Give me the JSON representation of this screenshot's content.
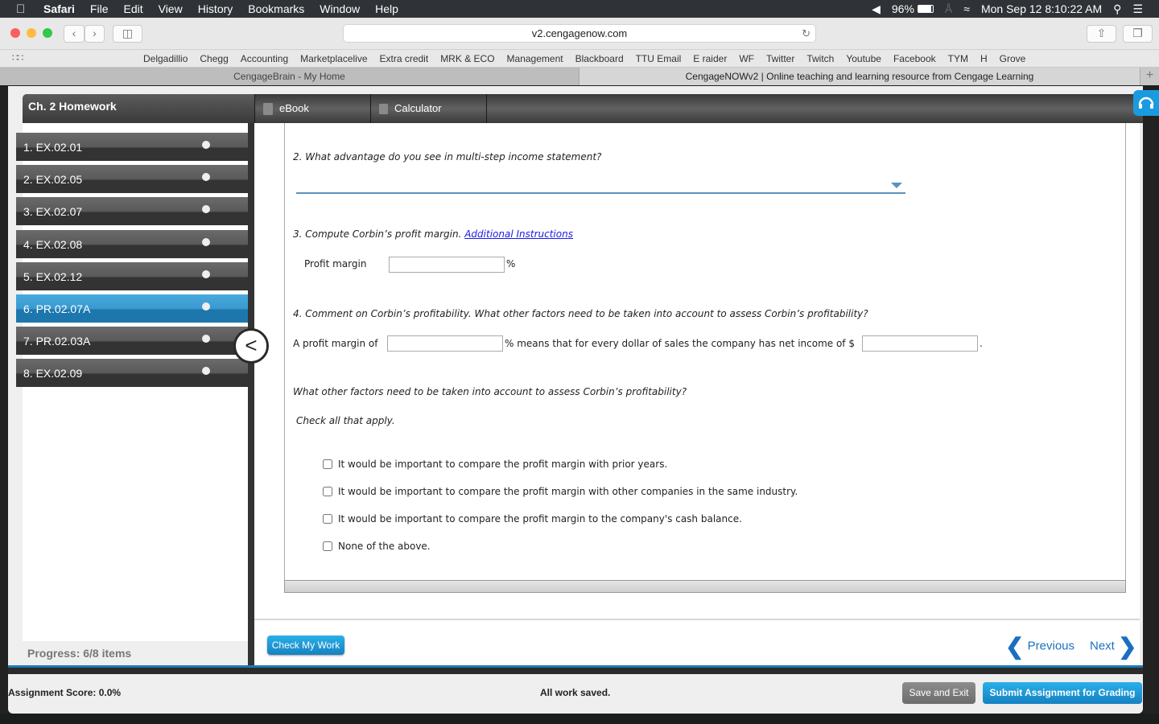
{
  "menubar": {
    "app": "Safari",
    "items": [
      "File",
      "Edit",
      "View",
      "History",
      "Bookmarks",
      "Window",
      "Help"
    ],
    "battery": "96%",
    "clock": "Mon Sep 12  8:10:22 AM"
  },
  "browser": {
    "url": "v2.cengagenow.com",
    "bookmarks": [
      "Delgadillio",
      "Chegg",
      "Accounting",
      "Marketplacelive",
      "Extra credit",
      "MRK & ECO",
      "Management",
      "Blackboard",
      "TTU Email",
      "E raider",
      "WF",
      "Twitter",
      "Twitch",
      "Youtube",
      "Facebook",
      "TYM",
      "H",
      "Grove"
    ],
    "tabs": [
      {
        "title": "CengageBrain - My Home",
        "active": false
      },
      {
        "title": "CengageNOWv2 | Online teaching and learning resource from Cengage Learning",
        "active": true
      }
    ]
  },
  "assignment": {
    "title": "Ch. 2 Homework",
    "tools": [
      "eBook",
      "Calculator"
    ],
    "items": [
      {
        "label": "1. EX.02.01",
        "active": false
      },
      {
        "label": "2. EX.02.05",
        "active": false
      },
      {
        "label": "3. EX.02.07",
        "active": false
      },
      {
        "label": "4. EX.02.08",
        "active": false
      },
      {
        "label": "5. EX.02.12",
        "active": false
      },
      {
        "label": "6. PR.02.07A",
        "active": true
      },
      {
        "label": "7. PR.02.03A",
        "active": false
      },
      {
        "label": "8. EX.02.09",
        "active": false
      }
    ],
    "progress": "Progress:  6/8 items"
  },
  "question": {
    "q2": "2. What advantage do you see in multi-step income statement?",
    "q2_selected": "",
    "q3": "3. Compute Corbin’s profit margin. ",
    "q3_link": "Additional Instructions",
    "profit_margin_label": "Profit margin",
    "profit_margin_value": "",
    "percent": "%",
    "q4": "4. Comment on Corbin’s profitability. What other factors need to be taken into account to assess Corbin’s profitability?",
    "sentence_a": "A profit margin of",
    "sentence_b": "% means that for every dollar of sales the company has net income of $",
    "sentence_end": ".",
    "factors_q": "What other factors need to be taken into account to assess Corbin’s profitability?",
    "check_all": "Check all that apply.",
    "options": [
      {
        "label": "It would be important to compare the profit margin with prior years.",
        "checked": false
      },
      {
        "label": "It would be important to compare the profit margin with other companies in the same industry.",
        "checked": false
      },
      {
        "label": "It would be important to compare the profit margin to the company's cash balance.",
        "checked": false
      },
      {
        "label": "None of the above.",
        "checked": false
      }
    ]
  },
  "footer": {
    "check_my_work": "Check My Work",
    "previous": "Previous",
    "next": "Next",
    "score": "Assignment Score: 0.0%",
    "saved": "All work saved.",
    "save_exit": "Save and Exit",
    "submit": "Submit Assignment for Grading"
  }
}
